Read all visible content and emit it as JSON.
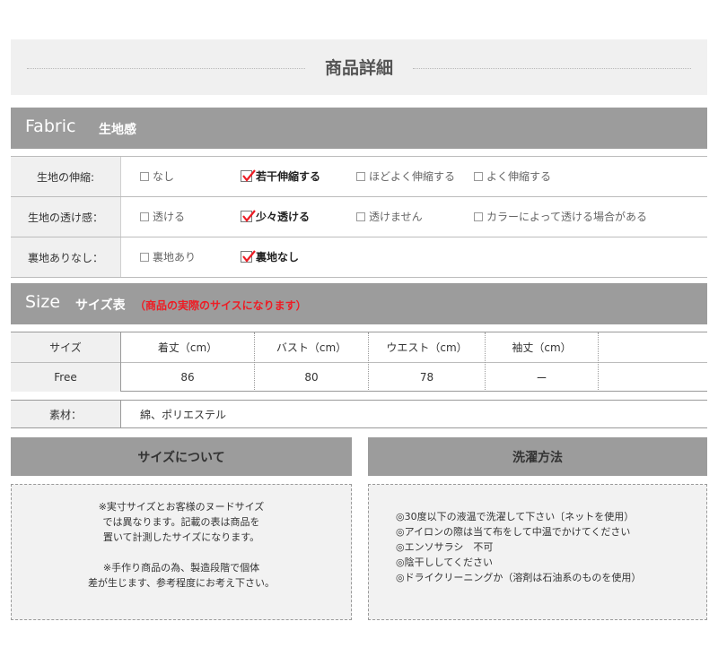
{
  "page_title": "商品詳細",
  "fabric": {
    "heading_en": "Fabric",
    "heading_jp": "生地感",
    "rows": [
      {
        "label": "生地の伸縮:",
        "options": [
          {
            "label": "なし",
            "checked": false
          },
          {
            "label": "若干伸縮する",
            "checked": true
          },
          {
            "label": "ほどよく伸縮する",
            "checked": false
          },
          {
            "label": "よく伸縮する",
            "checked": false
          }
        ]
      },
      {
        "label": "生地の透け感：",
        "options": [
          {
            "label": "透ける",
            "checked": false
          },
          {
            "label": "少々透ける",
            "checked": true
          },
          {
            "label": "透けません",
            "checked": false
          },
          {
            "label": "カラーによって透ける場合がある",
            "checked": false
          }
        ]
      },
      {
        "label": "裏地ありなし：",
        "options": [
          {
            "label": "裏地あり",
            "checked": false
          },
          {
            "label": "裏地なし",
            "checked": true
          }
        ]
      }
    ]
  },
  "size": {
    "heading_en": "Size",
    "heading_jp": "サイズ表",
    "note": "（商品の実際のサイスになります）",
    "columns": [
      "サイズ",
      "着丈（cm）",
      "バスト（cm）",
      "ウエスト（cm）",
      "袖丈（cm）",
      ""
    ],
    "rows": [
      [
        "Free",
        "86",
        "80",
        "78",
        "ー",
        ""
      ]
    ],
    "material_label": "素材：",
    "material_value": "綿、ポリエステル"
  },
  "about_size": {
    "heading": "サイズについて",
    "paragraphs": [
      [
        "※実寸サイズとお客様のヌードサイズ",
        "では異なります。記載の表は商品を",
        "置いて計測したサイズになります。"
      ],
      [
        "※手作り商品の為、製造段階で個体",
        "差が生じます、参考程度にお考え下さい。"
      ]
    ]
  },
  "washing": {
    "heading": "洗濯方法",
    "lines": [
      "◎30度以下の液温で洗濯して下さい〔ネットを使用）",
      "◎アイロンの際は当て布をして中温でかけてください",
      "◎エンソサラシ　不可",
      "◎陰干ししてください",
      "◎ドライクリーニングか（溶剤は石油系のものを使用）"
    ]
  },
  "colors": {
    "header_gray": "#9c9c9c",
    "light_gray": "#f0f0f0",
    "check_red": "#ee1c24"
  }
}
